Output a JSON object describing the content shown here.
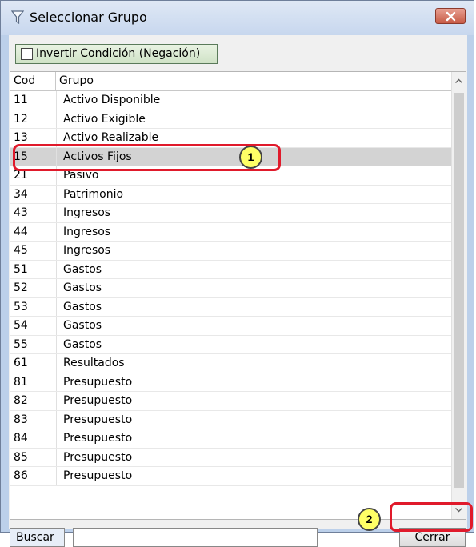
{
  "window": {
    "title": "Seleccionar Grupo"
  },
  "toolbar": {
    "invert_label": "Invertir Condición (Negación)"
  },
  "grid": {
    "columns": [
      "Cod",
      "Grupo"
    ],
    "rows": [
      {
        "cod": "11",
        "grupo": "Activo Disponible"
      },
      {
        "cod": "12",
        "grupo": "Activo Exigible"
      },
      {
        "cod": "13",
        "grupo": "Activo Realizable"
      },
      {
        "cod": "15",
        "grupo": "Activos Fijos"
      },
      {
        "cod": "21",
        "grupo": "Pasivo"
      },
      {
        "cod": "34",
        "grupo": "Patrimonio"
      },
      {
        "cod": "43",
        "grupo": "Ingresos"
      },
      {
        "cod": "44",
        "grupo": "Ingresos"
      },
      {
        "cod": "45",
        "grupo": "Ingresos"
      },
      {
        "cod": "51",
        "grupo": "Gastos"
      },
      {
        "cod": "52",
        "grupo": "Gastos"
      },
      {
        "cod": "53",
        "grupo": "Gastos"
      },
      {
        "cod": "54",
        "grupo": "Gastos"
      },
      {
        "cod": "55",
        "grupo": "Gastos"
      },
      {
        "cod": "61",
        "grupo": "Resultados"
      },
      {
        "cod": "81",
        "grupo": "Presupuesto"
      },
      {
        "cod": "82",
        "grupo": "Presupuesto"
      },
      {
        "cod": "83",
        "grupo": "Presupuesto"
      },
      {
        "cod": "84",
        "grupo": "Presupuesto"
      },
      {
        "cod": "85",
        "grupo": "Presupuesto"
      },
      {
        "cod": "86",
        "grupo": "Presupuesto"
      }
    ],
    "selected_cod": "15"
  },
  "footer": {
    "search_label": "Buscar",
    "search_value": "",
    "close_label": "Cerrar"
  },
  "annotations": {
    "callout_1": "1",
    "callout_2": "2"
  },
  "colors": {
    "callout_border": "#e01a2b",
    "callout_fill": "#ffff66",
    "selected_row": "#d3d3d3"
  }
}
